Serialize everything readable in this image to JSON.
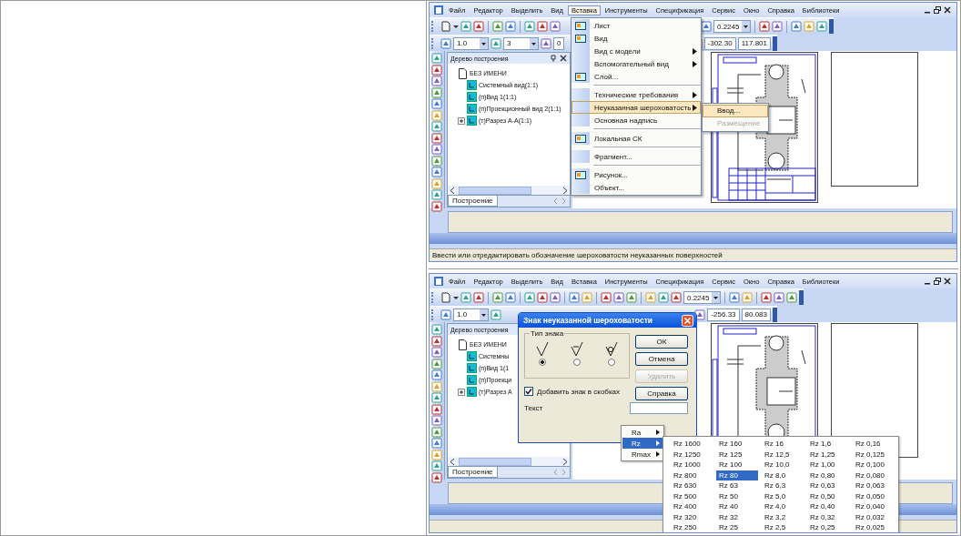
{
  "screenshots": [
    {
      "menu_bar": [
        {
          "label": "Файл",
          "selected": false
        },
        {
          "label": "Редактор",
          "selected": false
        },
        {
          "label": "Выделить",
          "selected": false
        },
        {
          "label": "Вид",
          "selected": false
        },
        {
          "label": "Вставка",
          "selected": true
        },
        {
          "label": "Инструменты",
          "selected": false
        },
        {
          "label": "Спецификация",
          "selected": false
        },
        {
          "label": "Сервис",
          "selected": false
        },
        {
          "label": "Окно",
          "selected": false
        },
        {
          "label": "Справка",
          "selected": false
        },
        {
          "label": "Библиотеки",
          "selected": false
        }
      ],
      "toolbar_1": [
        {
          "kind": "icon"
        },
        {
          "kind": "caret"
        },
        {
          "kind": "icon"
        },
        {
          "kind": "icon"
        },
        {
          "kind": "separator"
        },
        {
          "kind": "icon"
        },
        {
          "kind": "icon"
        },
        {
          "kind": "separator"
        },
        {
          "kind": "icon"
        },
        {
          "kind": "icon"
        },
        {
          "kind": "icon"
        },
        {
          "kind": "gap"
        },
        {
          "kind": "icon"
        },
        {
          "kind": "combo",
          "value": "0.2245"
        },
        {
          "kind": "separator"
        },
        {
          "kind": "icon"
        },
        {
          "kind": "icon"
        },
        {
          "kind": "separator"
        },
        {
          "kind": "icon"
        },
        {
          "kind": "icon"
        },
        {
          "kind": "icon"
        }
      ],
      "toolbar_2": [
        {
          "kind": "icon"
        },
        {
          "kind": "combo",
          "value": "1.0"
        },
        {
          "kind": "icon"
        },
        {
          "kind": "combo",
          "value": "3"
        },
        {
          "kind": "icon"
        },
        {
          "kind": "field",
          "value": "0"
        },
        {
          "kind": "gap"
        },
        {
          "kind": "icon"
        },
        {
          "kind": "field",
          "value": "-302.30"
        },
        {
          "kind": "field",
          "value": "117.801"
        }
      ],
      "tree": {
        "title": "Дерево построения",
        "items": [
          {
            "label": "БЕЗ ИМЕНИ",
            "collapsed": false,
            "children": [
              {
                "label": "Системный вид(1:1)",
                "collapsed": false
              },
              {
                "label": "(п)Вид 1(1:1)",
                "collapsed": false
              },
              {
                "label": "(п)Проекционный вид 2(1:1)",
                "collapsed": false
              },
              {
                "label": "(т)Разрез А-А(1:1)",
                "collapsed": true
              }
            ]
          }
        ],
        "tab": "Построение"
      },
      "status_text": "Ввести или отредактировать обозначение шероховатости неуказанных поверхностей",
      "open_menu": {
        "items": [
          {
            "kind": "item",
            "label": "Лист",
            "has_icon": true,
            "submenu": false,
            "selected": false
          },
          {
            "kind": "item",
            "label": "Вид",
            "has_icon": true,
            "submenu": false,
            "selected": false
          },
          {
            "kind": "item",
            "label": "Вид с модели",
            "has_icon": false,
            "submenu": true,
            "selected": false
          },
          {
            "kind": "item",
            "label": "Вспомогательный вид",
            "has_icon": false,
            "submenu": true,
            "selected": false
          },
          {
            "kind": "item",
            "label": "Слой...",
            "has_icon": true,
            "submenu": false,
            "selected": false
          },
          {
            "kind": "separator"
          },
          {
            "kind": "item",
            "label": "Технические требования",
            "has_icon": false,
            "submenu": true,
            "selected": false
          },
          {
            "kind": "item",
            "label": "Неуказанная шероховатость",
            "has_icon": false,
            "submenu": true,
            "selected": true
          },
          {
            "kind": "item",
            "label": "Основная надпись",
            "has_icon": false,
            "submenu": false,
            "selected": false
          },
          {
            "kind": "separator"
          },
          {
            "kind": "item",
            "label": "Локальная СК",
            "has_icon": true,
            "submenu": false,
            "selected": false
          },
          {
            "kind": "separator"
          },
          {
            "kind": "item",
            "label": "Фрагмент...",
            "has_icon": false,
            "submenu": false,
            "selected": false
          },
          {
            "kind": "separator"
          },
          {
            "kind": "item",
            "label": "Рисунок...",
            "has_icon": true,
            "submenu": false,
            "selected": false
          },
          {
            "kind": "item",
            "label": "Объект...",
            "has_icon": false,
            "submenu": false,
            "selected": false
          }
        ]
      },
      "submenu": [
        {
          "label": "Ввод...",
          "selected": true,
          "disabled": false
        },
        {
          "label": "Размещение",
          "selected": false,
          "disabled": true
        }
      ]
    },
    {
      "menu_bar": [
        {
          "label": "Файл",
          "selected": false
        },
        {
          "label": "Редактор",
          "selected": false
        },
        {
          "label": "Выделить",
          "selected": false
        },
        {
          "label": "Вид",
          "selected": false
        },
        {
          "label": "Вставка",
          "selected": false
        },
        {
          "label": "Инструменты",
          "selected": false
        },
        {
          "label": "Спецификация",
          "selected": false
        },
        {
          "label": "Сервис",
          "selected": false
        },
        {
          "label": "Окно",
          "selected": false
        },
        {
          "label": "Справка",
          "selected": false
        },
        {
          "label": "Библиотеки",
          "selected": false
        }
      ],
      "toolbar_1": [
        {
          "kind": "icon"
        },
        {
          "kind": "caret"
        },
        {
          "kind": "icon"
        },
        {
          "kind": "icon"
        },
        {
          "kind": "separator"
        },
        {
          "kind": "icon"
        },
        {
          "kind": "icon"
        },
        {
          "kind": "separator"
        },
        {
          "kind": "icon"
        },
        {
          "kind": "icon"
        },
        {
          "kind": "icon"
        },
        {
          "kind": "separator"
        },
        {
          "kind": "icon"
        },
        {
          "kind": "icon"
        },
        {
          "kind": "separator"
        },
        {
          "kind": "icon"
        },
        {
          "kind": "icon"
        },
        {
          "kind": "icon"
        },
        {
          "kind": "separator"
        },
        {
          "kind": "icon"
        },
        {
          "kind": "icon"
        },
        {
          "kind": "icon"
        },
        {
          "kind": "combo",
          "value": "0.2245"
        },
        {
          "kind": "separator"
        },
        {
          "kind": "icon"
        },
        {
          "kind": "icon"
        },
        {
          "kind": "separator"
        },
        {
          "kind": "icon"
        },
        {
          "kind": "icon"
        },
        {
          "kind": "icon"
        }
      ],
      "toolbar_2": [
        {
          "kind": "icon"
        },
        {
          "kind": "combo",
          "value": "1.0"
        },
        {
          "kind": "icon"
        },
        {
          "kind": "gap"
        },
        {
          "kind": "icon"
        },
        {
          "kind": "field",
          "value": "-256.33"
        },
        {
          "kind": "field",
          "value": "80.083"
        }
      ],
      "tree": {
        "title": "Дерево построения",
        "items": [
          {
            "label": "БЕЗ ИМЕНИ",
            "collapsed": false,
            "children": [
              {
                "label": "Системны",
                "collapsed": false
              },
              {
                "label": "(п)Вид 1(1",
                "collapsed": false
              },
              {
                "label": "(п)Проекци",
                "collapsed": false
              },
              {
                "label": "(т)Разрез А",
                "collapsed": true
              }
            ]
          }
        ],
        "tab": "Построение"
      },
      "dialog": {
        "title": "Знак неуказанной шероховатости",
        "group": "Тип знака",
        "sign_types": [
          {
            "kind": "basic",
            "selected": true
          },
          {
            "kind": "removal",
            "selected": false
          },
          {
            "kind": "no_removal",
            "selected": false
          }
        ],
        "bracket_checkbox": {
          "label": "Добавить знак в скобках",
          "checked": true
        },
        "text_label": "Текст",
        "buttons": [
          {
            "label": "ОК",
            "disabled": false
          },
          {
            "label": "Отмена",
            "disabled": false
          },
          {
            "label": "Удалить",
            "disabled": true
          },
          {
            "label": "Справка",
            "disabled": false
          }
        ]
      },
      "popup_menu": [
        {
          "label": "Ra",
          "selected": false
        },
        {
          "label": "Rz",
          "selected": true
        },
        {
          "label": "Rmax",
          "selected": false
        }
      ],
      "value_grid": [
        [
          {
            "label": "Rz 1600",
            "selected": false
          },
          {
            "label": "Rz 1250",
            "selected": false
          },
          {
            "label": "Rz 1000",
            "selected": false
          },
          {
            "label": "Rz 800",
            "selected": false
          },
          {
            "label": "Rz 630",
            "selected": false
          },
          {
            "label": "Rz 500",
            "selected": false
          },
          {
            "label": "Rz 400",
            "selected": false
          },
          {
            "label": "Rz 320",
            "selected": false
          },
          {
            "label": "Rz 250",
            "selected": false
          }
        ],
        [
          {
            "label": "Rz 160",
            "selected": false
          },
          {
            "label": "Rz 125",
            "selected": false
          },
          {
            "label": "Rz 100",
            "selected": false
          },
          {
            "label": "Rz 80",
            "selected": true
          },
          {
            "label": "Rz 63",
            "selected": false
          },
          {
            "label": "Rz 50",
            "selected": false
          },
          {
            "label": "Rz 40",
            "selected": false
          },
          {
            "label": "Rz 32",
            "selected": false
          },
          {
            "label": "Rz 25",
            "selected": false
          }
        ],
        [
          {
            "label": "Rz 16",
            "selected": false
          },
          {
            "label": "Rz 12,5",
            "selected": false
          },
          {
            "label": "Rz 10,0",
            "selected": false
          },
          {
            "label": "Rz 8,0",
            "selected": false
          },
          {
            "label": "Rz 6,3",
            "selected": false
          },
          {
            "label": "Rz 5,0",
            "selected": false
          },
          {
            "label": "Rz 4,0",
            "selected": false
          },
          {
            "label": "Rz 3,2",
            "selected": false
          },
          {
            "label": "Rz 2,5",
            "selected": false
          }
        ],
        [
          {
            "label": "Rz 1,6",
            "selected": false
          },
          {
            "label": "Rz 1,25",
            "selected": false
          },
          {
            "label": "Rz 1,00",
            "selected": false
          },
          {
            "label": "Rz 0,80",
            "selected": false
          },
          {
            "label": "Rz 0,63",
            "selected": false
          },
          {
            "label": "Rz 0,50",
            "selected": false
          },
          {
            "label": "Rz 0,40",
            "selected": false
          },
          {
            "label": "Rz 0,32",
            "selected": false
          },
          {
            "label": "Rz 0,25",
            "selected": false
          }
        ],
        [
          {
            "label": "Rz 0,16",
            "selected": false
          },
          {
            "label": "Rz 0,125",
            "selected": false
          },
          {
            "label": "Rz 0,100",
            "selected": false
          },
          {
            "label": "Rz 0,080",
            "selected": false
          },
          {
            "label": "Rz 0,063",
            "selected": false
          },
          {
            "label": "Rz 0,050",
            "selected": false
          },
          {
            "label": "Rz 0,040",
            "selected": false
          },
          {
            "label": "Rz 0,032",
            "selected": false
          },
          {
            "label": "Rz 0,025",
            "selected": false
          }
        ]
      ]
    }
  ]
}
